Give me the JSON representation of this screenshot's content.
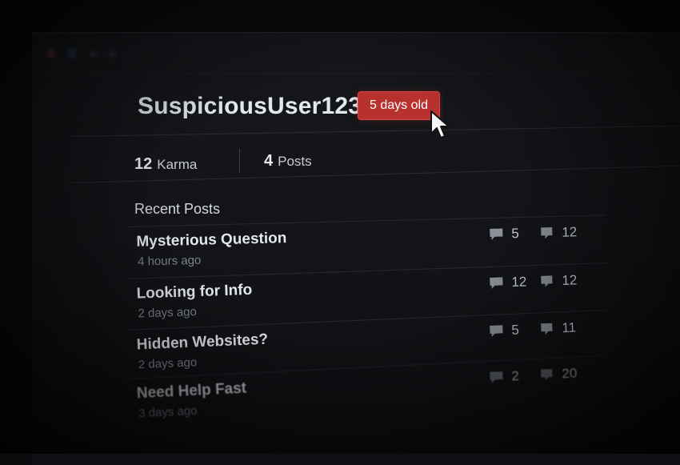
{
  "profile": {
    "username": "SuspiciousUser123",
    "age_badge": "5 days old",
    "badge_color": "#b8312f"
  },
  "stats": {
    "karma_value": "12",
    "karma_label": "Karma",
    "posts_value": "4",
    "posts_label": "Posts"
  },
  "recent_posts": {
    "heading": "Recent Posts",
    "items": [
      {
        "title": "Mysterious Question",
        "time": "4 hours ago",
        "comments": "5",
        "votes": "12"
      },
      {
        "title": "Looking for Info",
        "time": "2 days ago",
        "comments": "12",
        "votes": "12"
      },
      {
        "title": "Hidden Websites?",
        "time": "2 days ago",
        "comments": "5",
        "votes": "11"
      },
      {
        "title": "Need Help Fast",
        "time": "3 days ago",
        "comments": "2",
        "votes": "20"
      }
    ]
  },
  "icons": {
    "comment": "comment-icon",
    "vote": "vote-icon",
    "cursor": "mouse-pointer-icon"
  }
}
